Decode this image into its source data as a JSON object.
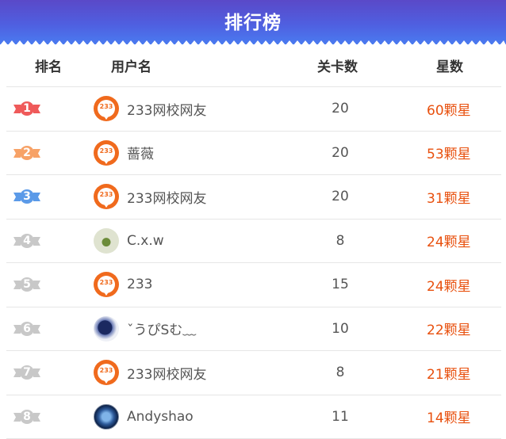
{
  "header": {
    "title": "排行榜"
  },
  "columns": {
    "rank": "排名",
    "user": "用户名",
    "level": "关卡数",
    "stars": "星数"
  },
  "rows": [
    {
      "rank": "1",
      "badge_color": "#ef5a5a",
      "avatar": "brand",
      "avatar_text": "233",
      "name": "233网校网友",
      "level": "20",
      "stars": "60颗星"
    },
    {
      "rank": "2",
      "badge_color": "#f7a267",
      "avatar": "brand",
      "avatar_text": "233",
      "name": "蔷薇",
      "level": "20",
      "stars": "53颗星"
    },
    {
      "rank": "3",
      "badge_color": "#5b9ae8",
      "avatar": "brand",
      "avatar_text": "233",
      "name": "233网校网友",
      "level": "20",
      "stars": "31颗星"
    },
    {
      "rank": "4",
      "badge_color": "#c8c8c8",
      "avatar": "plant",
      "name": "C.x.w",
      "level": "8",
      "stars": "24颗星"
    },
    {
      "rank": "5",
      "badge_color": "#c8c8c8",
      "avatar": "brand",
      "avatar_text": "233",
      "name": "233",
      "level": "15",
      "stars": "24颗星"
    },
    {
      "rank": "6",
      "badge_color": "#c8c8c8",
      "avatar": "dark",
      "name": "ˇうぴSむ﹏",
      "level": "10",
      "stars": "22颗星"
    },
    {
      "rank": "7",
      "badge_color": "#c8c8c8",
      "avatar": "brand",
      "avatar_text": "233",
      "name": "233网校网友",
      "level": "8",
      "stars": "21颗星"
    },
    {
      "rank": "8",
      "badge_color": "#c8c8c8",
      "avatar": "blue",
      "name": "Andyshao",
      "level": "11",
      "stars": "14颗星"
    }
  ],
  "colors": {
    "header_top": "#5a49c8",
    "header_bottom": "#4a7bf0",
    "stars_text": "#e8500e"
  }
}
